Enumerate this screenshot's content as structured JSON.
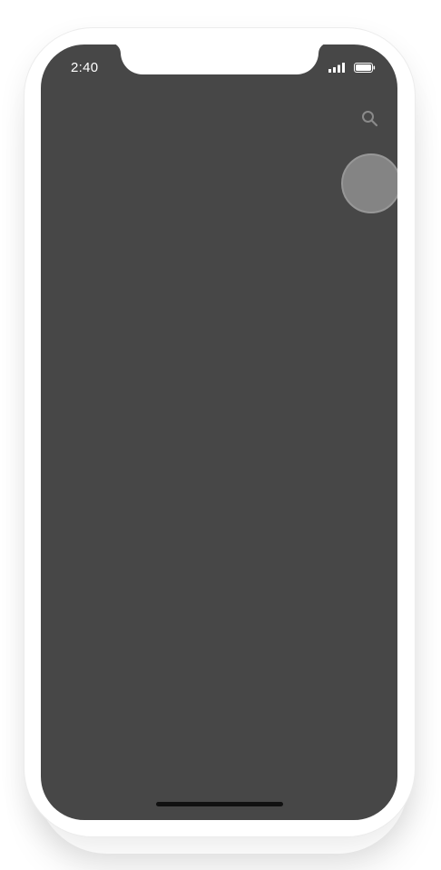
{
  "status_bar": {
    "time": "2:40",
    "signal_icon": "cellular-signal-icon",
    "battery_icon": "battery-icon"
  },
  "toolbar": {
    "search_icon": "search-icon"
  },
  "colors": {
    "screen_background": "#474747",
    "status_text": "#ffffff",
    "icon_gray": "#8a8a8a",
    "touch_indicator": "#888888",
    "home_indicator": "#111111",
    "device_frame": "#ffffff"
  }
}
